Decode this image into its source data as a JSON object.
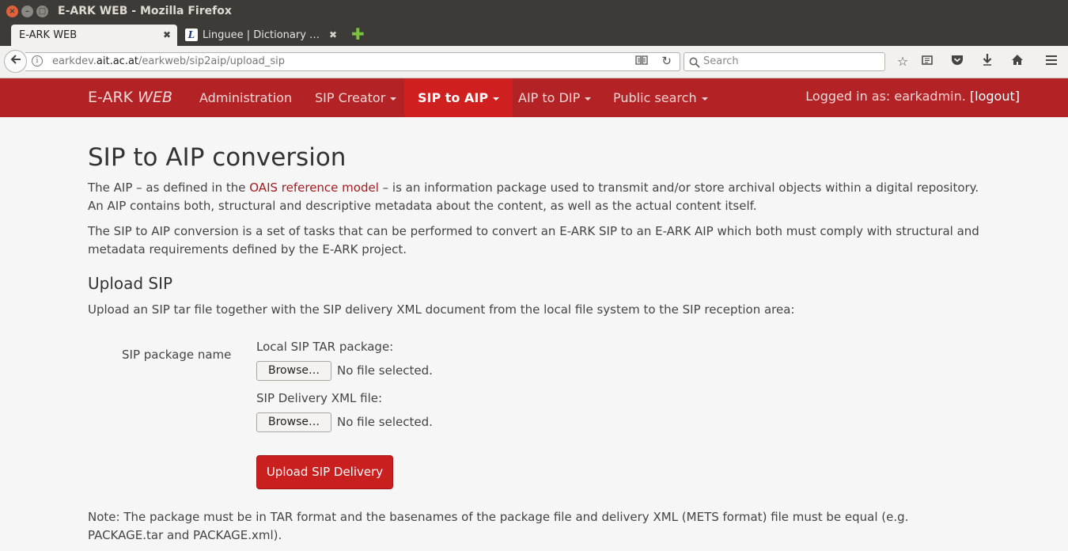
{
  "window": {
    "title": "E-ARK WEB - Mozilla Firefox"
  },
  "tabs": [
    {
      "label": "E-ARK WEB",
      "close": "✖"
    },
    {
      "label": "Linguee | Dictionary …",
      "close": "✖"
    }
  ],
  "browser": {
    "url_prefix": "earkdev.",
    "url_domain": "ait.ac.at",
    "url_path": "/earkweb/sip2aip/upload_sip",
    "search_placeholder": "Search",
    "icons": [
      "back-icon",
      "info-icon",
      "reader-view-icon",
      "reload-icon",
      "search-icon",
      "bookmark-star-icon",
      "reading-list-icon",
      "pocket-icon",
      "download-icon",
      "home-icon",
      "menu-icon"
    ]
  },
  "header": {
    "brand_main": "E-ARK ",
    "brand_italic": "WEB",
    "nav": [
      {
        "label": "Administration"
      },
      {
        "label": "SIP Creator"
      },
      {
        "label": "SIP to AIP"
      },
      {
        "label": "AIP to DIP"
      },
      {
        "label": "Public search"
      }
    ],
    "login_text": "Logged in as: earkadmin. ",
    "logout_label": "[logout]",
    "colors": {
      "bar": "#b32224",
      "active": "#cf1f1f"
    }
  },
  "page": {
    "title": "SIP to AIP conversion",
    "intro_1_before": "The AIP – as defined in the ",
    "intro_1_link": "OAIS reference model",
    "intro_1_after": " – is an information package used to transmit and/or store archival objects within a digital repository. An AIP contains both, structural and descriptive metadata about the content, as well as the actual content itself.",
    "intro_2": "The SIP to AIP conversion is a set of tasks that can be performed to convert an E-ARK SIP to an E-ARK AIP which both must comply with structural and metadata requirements defined by the E-ARK project.",
    "upload_heading": "Upload SIP",
    "upload_desc": "Upload an SIP tar file together with the SIP delivery XML document from the local file system to the SIP reception area:",
    "form": {
      "package_label": "SIP package name",
      "tar_label": "Local SIP TAR package:",
      "xml_label": "SIP Delivery XML file:",
      "browse_label": "Browse…",
      "no_file": "No file selected.",
      "submit_label": "Upload SIP Delivery"
    },
    "note": "Note: The package must be in TAR format and the basenames of the package file and delivery XML (METS format) file must be equal (e.g. PACKAGE.tar and PACKAGE.xml)."
  }
}
